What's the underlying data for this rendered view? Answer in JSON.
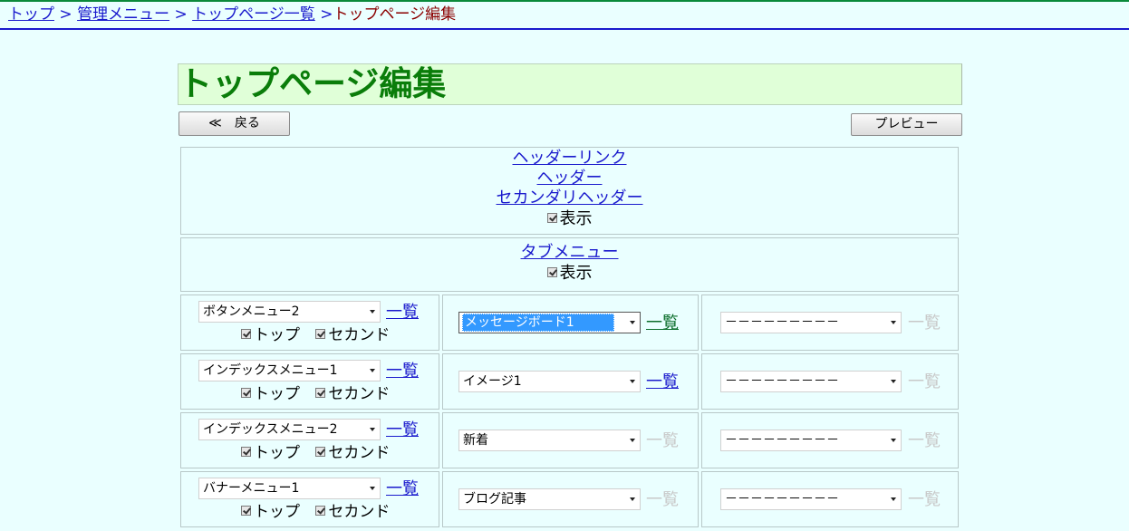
{
  "breadcrumb": {
    "items": [
      "トップ",
      "管理メニュー",
      "トップページ一覧"
    ],
    "separator": ">",
    "current": "トップページ編集"
  },
  "page": {
    "title": "トップページ編集"
  },
  "toolbar": {
    "back_label": "≪　戻る",
    "preview_label": "プレビュー"
  },
  "header_panel": {
    "links": [
      "ヘッダーリンク",
      "ヘッダー",
      "セカンダリヘッダー"
    ],
    "show_label": "表示"
  },
  "tab_panel": {
    "link": "タブメニュー",
    "show_label": "表示"
  },
  "grid": {
    "list_label": "一覧",
    "top_label": "トップ",
    "second_label": "セカンド",
    "rows": [
      {
        "col1": "ボタンメニュー2",
        "col2": "メッセージボード1",
        "col3": "－－－－－－－－－"
      },
      {
        "col1": "インデックスメニュー1",
        "col2": "イメージ1",
        "col3": "－－－－－－－－－"
      },
      {
        "col1": "インデックスメニュー2",
        "col2": "新着",
        "col3": "－－－－－－－－－"
      },
      {
        "col1": "バナーメニュー1",
        "col2": "ブログ記事",
        "col3": "－－－－－－－－－"
      }
    ]
  }
}
